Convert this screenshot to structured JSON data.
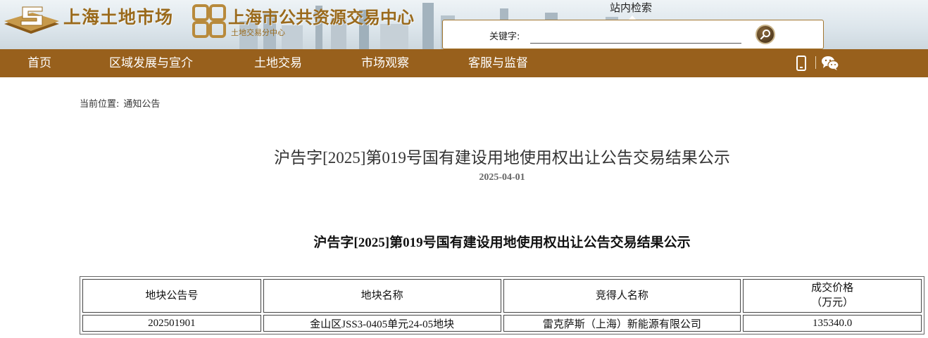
{
  "header": {
    "logo1_text": "上海土地市场",
    "logo2_text": "上海市公共资源交易中心",
    "logo2_sub": "土地交易分中心",
    "brand_color": "#98601c",
    "search": {
      "title": "站内检索",
      "label": "关键字:",
      "value": "",
      "button_icon": "search-icon"
    }
  },
  "nav": {
    "items": [
      "首页",
      "区域发展与宣介",
      "土地交易",
      "市场观察",
      "客服与监督"
    ],
    "icons": [
      "mobile-phone-icon",
      "wechat-icon"
    ]
  },
  "breadcrumb": {
    "prefix": "当前位置:",
    "current": "通知公告"
  },
  "article": {
    "title": "沪告字[2025]第019号国有建设用地使用权出让公告交易结果公示",
    "date": "2025-04-01",
    "body_title": "沪告字[2025]第019号国有建设用地使用权出让公告交易结果公示",
    "table": {
      "headers": [
        "地块公告号",
        "地块名称",
        "竞得人名称",
        "成交价格",
        "（万元）"
      ],
      "rows": [
        [
          "202501901",
          "金山区JSS3-0405单元24-05地块",
          "雷克萨斯（上海）新能源有限公司",
          "135340.0"
        ]
      ]
    }
  }
}
